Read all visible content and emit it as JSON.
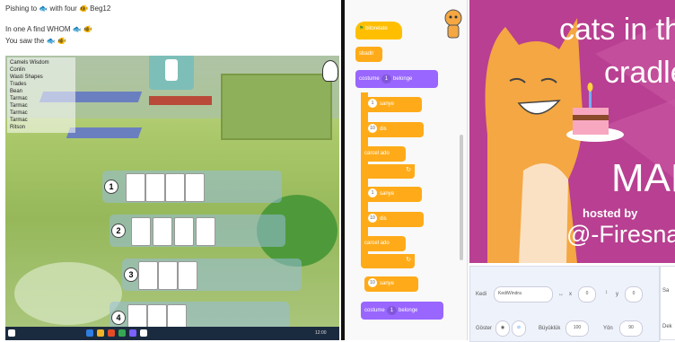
{
  "game": {
    "line1": "Pishing to 🐟 with four 🐠 Beg12",
    "line2": "In one A find WHOM 🐟 🐠",
    "line3": "You saw the 🐟 🐠",
    "legend": [
      "Camels Wisdom",
      "Conlin",
      "Wasti Shapes",
      "Trades",
      "Bean",
      "Tarmac",
      "Tarmac",
      "Tarmac",
      "Tarmac",
      "Ritson"
    ],
    "score_label": "0000",
    "rows": [
      "1",
      "2",
      "3",
      "4"
    ],
    "taskbar_text": "12:00"
  },
  "scratch": {
    "hat_label": "bitorelate",
    "blocks": [
      {
        "type": "yellow",
        "label": "sbadir"
      },
      {
        "type": "purple",
        "label": "costume",
        "dropdown": "1",
        "suffix": "belonge"
      },
      {
        "type": "yellow",
        "label": "turn",
        "oval": "1",
        "suffix": "sanye"
      },
      {
        "type": "yellow",
        "label": "move",
        "oval": "10",
        "suffix": "dis"
      },
      {
        "type": "yellow",
        "label": "carcel",
        "suffix": "ado"
      },
      {
        "type": "yellow",
        "label": "turn",
        "oval": "1",
        "suffix": "sanye"
      },
      {
        "type": "yellow",
        "label": "move",
        "oval": "10",
        "suffix": "dis"
      },
      {
        "type": "yellow",
        "label": "carcel",
        "suffix": "ado"
      },
      {
        "type": "yellow",
        "label": "wait",
        "oval": "10",
        "suffix": "sanye"
      },
      {
        "type": "purple",
        "label": "costume",
        "dropdown": "1",
        "suffix": "belonge"
      }
    ]
  },
  "stage": {
    "title_line1": "cats in the",
    "title_line2": "cradle",
    "map": "MAP",
    "hosted_by": "hosted by",
    "host": "@-Firesnake-",
    "sprite_label": "Kedi",
    "sprite_name": "KediWindra",
    "x_label": "x",
    "x_value": "0",
    "y_label": "y",
    "y_value": "0",
    "show_label": "Göster",
    "size_label": "Büyüklük",
    "size_value": "100",
    "dir_label": "Yön",
    "dir_value": "90",
    "side_label1": "Sa",
    "side_label2": "Dek"
  },
  "colors": {
    "stage_bg": "#b83f91",
    "scratch_yellow": "#ffab19",
    "scratch_purple": "#9966ff"
  }
}
